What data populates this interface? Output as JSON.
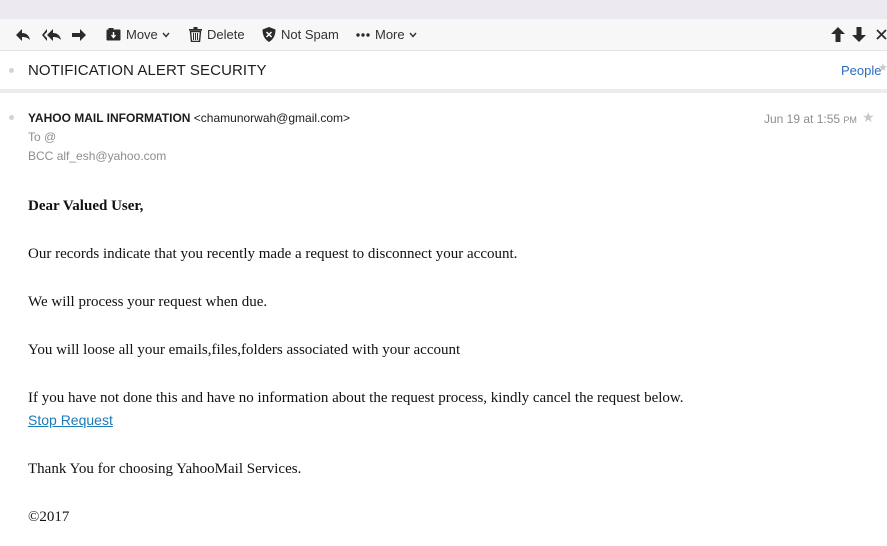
{
  "toolbar": {
    "reply_icon": "reply-icon",
    "reply_all_icon": "reply-all-icon",
    "forward_icon": "forward-icon",
    "move_label": "Move",
    "delete_label": "Delete",
    "not_spam_label": "Not Spam",
    "more_label": "More",
    "prev_icon": "arrow-up-icon",
    "next_icon": "arrow-down-icon",
    "close_icon": "close-icon"
  },
  "message": {
    "subject": "NOTIFICATION ALERT SECURITY",
    "people_label": "People",
    "from_name": "YAHOO MAIL INFORMATION",
    "from_email": "<chamunorwah@gmail.com>",
    "to_label": "To",
    "to_value": "@",
    "bcc_label": "BCC",
    "bcc_value": "alf_esh@yahoo.com",
    "date": "Jun 19 at 1:55",
    "date_suffix": "PM"
  },
  "body": {
    "greeting": "Dear Valued User,",
    "line1": "Our records indicate that you recently made a request to disconnect your account.",
    "line2": "We will process your request when due.",
    "line3": "You will loose all your emails,files,folders associated with your account",
    "line4": "If you have not done this and have no information about the request process, kindly cancel the request below.",
    "link": "Stop Request",
    "thanks": "Thank You for choosing YahooMail Services.",
    "copyright": "©2017"
  },
  "colors": {
    "link": "#1c7bb8",
    "people_link": "#2a6ebb",
    "toolbar_bg": "#f7f7f8",
    "top_strip": "#ede9f1"
  }
}
